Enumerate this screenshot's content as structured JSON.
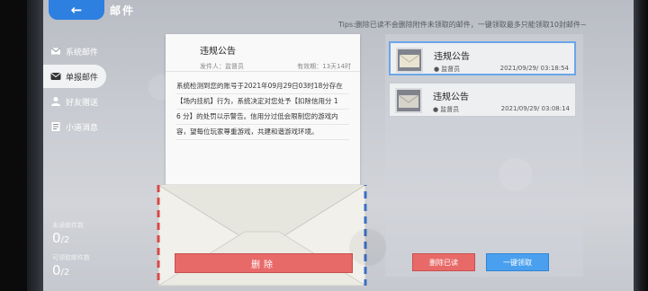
{
  "header": {
    "title": "邮件"
  },
  "tips": "Tips:删除已读不会删除附件未领取的邮件，一键领取最多只能领取10封邮件~",
  "sidebar": {
    "items": [
      {
        "label": "系统邮件",
        "icon": "mail-icon"
      },
      {
        "label": "单报邮件",
        "icon": "report-mail-icon"
      },
      {
        "label": "好友赠送",
        "icon": "friend-gift-icon"
      },
      {
        "label": "小道消息",
        "icon": "rumor-icon"
      }
    ],
    "unread_label": "未读邮件数",
    "unread_value": "0",
    "unread_total": "2",
    "claimable_label": "可领取邮件数",
    "claimable_value": "0",
    "claimable_total": "2"
  },
  "letter": {
    "title": "违规公告",
    "sender": "发件人：监督员",
    "validity": "有效期：13天14时",
    "body": [
      "系统检测到您的账号于2021年09月29日03时18分存在",
      "【场内挂机】行为，系统决定对您处予【扣除信用分 1",
      "6 分】的处罚以示警告。信用分过低会限制您的游戏内",
      "容，望每位玩家尊重游戏，共建和谐游戏环境。"
    ],
    "delete_button": "删除"
  },
  "mail_list": [
    {
      "title": "违规公告",
      "sender": "监督员",
      "time": "2021/09/29/ 03:18:54"
    },
    {
      "title": "违规公告",
      "sender": "监督员",
      "time": "2021/09/29/ 03:08:14"
    }
  ],
  "actions": {
    "delete_read": "删除已读",
    "claim_all": "一键领取"
  },
  "colors": {
    "accent_blue": "#2d7fe0",
    "delete_red": "#e86a68",
    "claim_blue": "#4aa0ee"
  }
}
